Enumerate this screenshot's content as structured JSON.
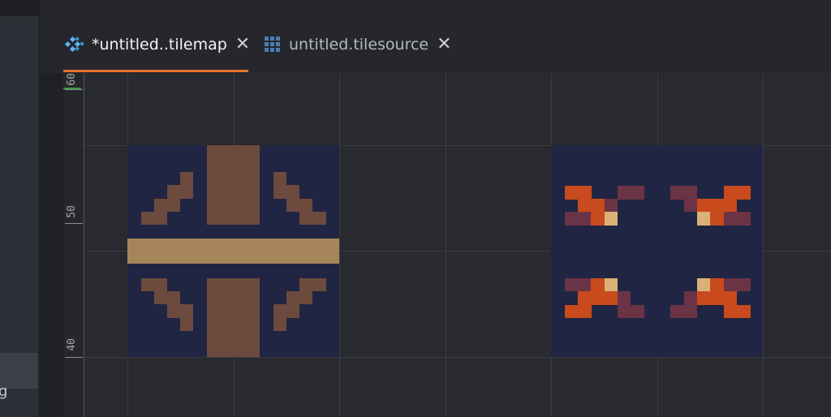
{
  "sidebar": {
    "cut_label": "g"
  },
  "tabs": [
    {
      "label": "*untitled..tilemap",
      "icon": "tilemap-icon",
      "active": true
    },
    {
      "label": "untitled.tilesource",
      "icon": "tilesource-icon",
      "active": false
    }
  ],
  "tab_close_glyph": "✕",
  "ruler": {
    "labels": [
      "60",
      "50",
      "40"
    ]
  },
  "colors": {
    "accent": "#e8732c",
    "tile_background": "#1f2542",
    "brown": "#6c4a3e",
    "tan": "#a6855a",
    "orange": "#c84a1d",
    "maroon": "#6b3346",
    "cream": "#d9b176"
  }
}
